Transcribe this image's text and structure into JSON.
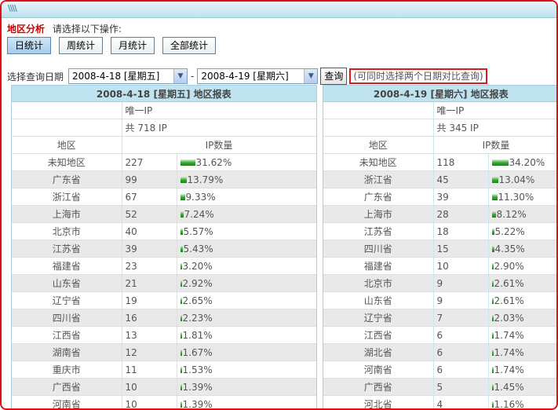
{
  "titlebar": {
    "text": "\\\\\\\\"
  },
  "header": {
    "title": "地区分析",
    "hint": "请选择以下操作:"
  },
  "tabs": [
    {
      "label": "日统计",
      "active": true
    },
    {
      "label": "周统计",
      "active": false
    },
    {
      "label": "月统计",
      "active": false
    },
    {
      "label": "全部统计",
      "active": false
    }
  ],
  "query": {
    "label": "选择查询日期",
    "date1": "2008-4-18 [星期五]",
    "date2": "2008-4-19 [星期六]",
    "separator": "-",
    "button": "查询",
    "note": "(可同时选择两个日期对比查询)"
  },
  "reports": [
    {
      "title": "2008-4-18 [星期五] 地区报表",
      "unique_ip_label": "唯一IP",
      "total_ip": "共 718 IP",
      "col_region": "地区",
      "col_ip": "IP数量",
      "rows": [
        {
          "region": "未知地区",
          "count": "227",
          "percent": "31.62%",
          "fraction": 0.3162
        },
        {
          "region": "广东省",
          "count": "99",
          "percent": "13.79%",
          "fraction": 0.1379
        },
        {
          "region": "浙江省",
          "count": "67",
          "percent": "9.33%",
          "fraction": 0.0933
        },
        {
          "region": "上海市",
          "count": "52",
          "percent": "7.24%",
          "fraction": 0.0724
        },
        {
          "region": "北京市",
          "count": "40",
          "percent": "5.57%",
          "fraction": 0.0557
        },
        {
          "region": "江苏省",
          "count": "39",
          "percent": "5.43%",
          "fraction": 0.0543
        },
        {
          "region": "福建省",
          "count": "23",
          "percent": "3.20%",
          "fraction": 0.032
        },
        {
          "region": "山东省",
          "count": "21",
          "percent": "2.92%",
          "fraction": 0.0292
        },
        {
          "region": "辽宁省",
          "count": "19",
          "percent": "2.65%",
          "fraction": 0.0265
        },
        {
          "region": "四川省",
          "count": "16",
          "percent": "2.23%",
          "fraction": 0.0223
        },
        {
          "region": "江西省",
          "count": "13",
          "percent": "1.81%",
          "fraction": 0.0181
        },
        {
          "region": "湖南省",
          "count": "12",
          "percent": "1.67%",
          "fraction": 0.0167
        },
        {
          "region": "重庆市",
          "count": "11",
          "percent": "1.53%",
          "fraction": 0.0153
        },
        {
          "region": "广西省",
          "count": "10",
          "percent": "1.39%",
          "fraction": 0.0139
        },
        {
          "region": "河南省",
          "count": "10",
          "percent": "1.39%",
          "fraction": 0.0139
        }
      ]
    },
    {
      "title": "2008-4-19 [星期六] 地区报表",
      "unique_ip_label": "唯一IP",
      "total_ip": "共 345 IP",
      "col_region": "地区",
      "col_ip": "IP数量",
      "rows": [
        {
          "region": "未知地区",
          "count": "118",
          "percent": "34.20%",
          "fraction": 0.342
        },
        {
          "region": "浙江省",
          "count": "45",
          "percent": "13.04%",
          "fraction": 0.1304
        },
        {
          "region": "广东省",
          "count": "39",
          "percent": "11.30%",
          "fraction": 0.113
        },
        {
          "region": "上海市",
          "count": "28",
          "percent": "8.12%",
          "fraction": 0.0812
        },
        {
          "region": "江苏省",
          "count": "18",
          "percent": "5.22%",
          "fraction": 0.0522
        },
        {
          "region": "四川省",
          "count": "15",
          "percent": "4.35%",
          "fraction": 0.0435
        },
        {
          "region": "福建省",
          "count": "10",
          "percent": "2.90%",
          "fraction": 0.029
        },
        {
          "region": "北京市",
          "count": "9",
          "percent": "2.61%",
          "fraction": 0.0261
        },
        {
          "region": "山东省",
          "count": "9",
          "percent": "2.61%",
          "fraction": 0.0261
        },
        {
          "region": "辽宁省",
          "count": "7",
          "percent": "2.03%",
          "fraction": 0.0203
        },
        {
          "region": "江西省",
          "count": "6",
          "percent": "1.74%",
          "fraction": 0.0174
        },
        {
          "region": "湖北省",
          "count": "6",
          "percent": "1.74%",
          "fraction": 0.0174
        },
        {
          "region": "河南省",
          "count": "6",
          "percent": "1.74%",
          "fraction": 0.0174
        },
        {
          "region": "广西省",
          "count": "5",
          "percent": "1.45%",
          "fraction": 0.0145
        },
        {
          "region": "河北省",
          "count": "4",
          "percent": "1.16%",
          "fraction": 0.0116
        }
      ]
    }
  ],
  "colors": {
    "frame_border": "#e01010",
    "section_title": "#d00000",
    "header_bg": "#bfe3ef",
    "bar": "#2e9a2e"
  }
}
